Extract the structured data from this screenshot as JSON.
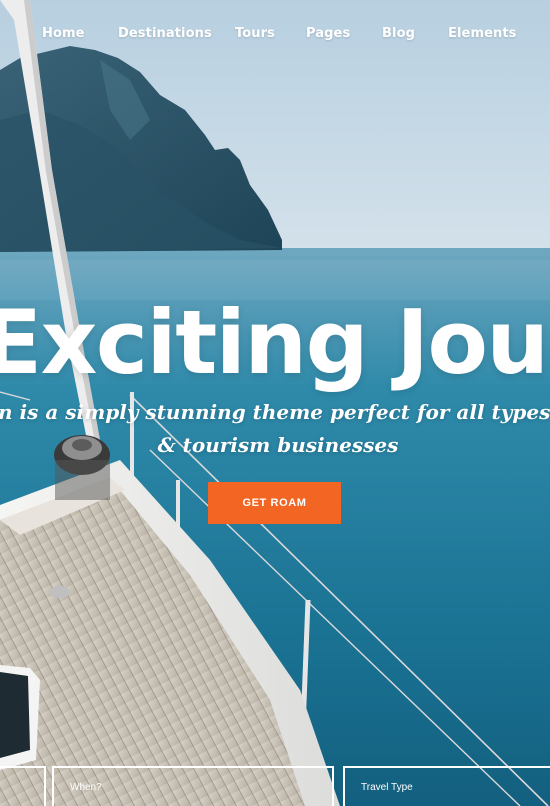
{
  "nav": {
    "items": [
      {
        "label": "Home"
      },
      {
        "label": "Destinations"
      },
      {
        "label": "Tours"
      },
      {
        "label": "Pages"
      },
      {
        "label": "Blog"
      },
      {
        "label": "Elements"
      }
    ]
  },
  "hero": {
    "title": "Exciting Jour",
    "subtitle_line1": "n is a simply stunning theme perfect for all types of t",
    "subtitle_line2": "& tourism businesses",
    "cta_label": "GET ROAM"
  },
  "search": {
    "when_label": "When?",
    "travel_type_label": "Travel Type"
  },
  "colors": {
    "accent": "#f26522",
    "sea": "#1f7797",
    "sky": "#c9dbe6",
    "text": "#ffffff"
  }
}
